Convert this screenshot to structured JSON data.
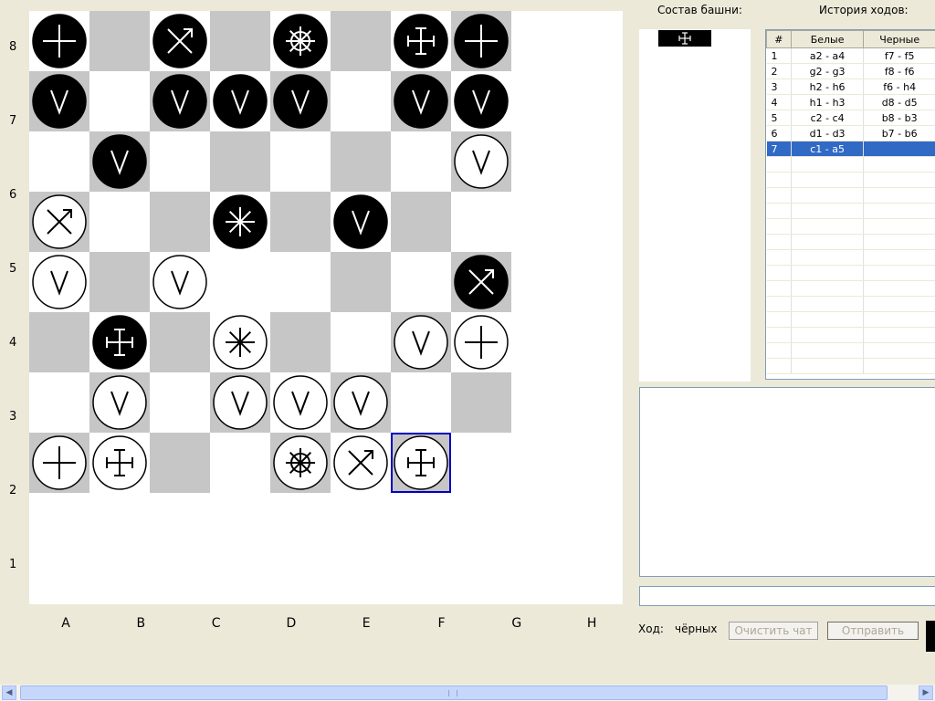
{
  "board": {
    "ranks": [
      "8",
      "7",
      "6",
      "5",
      "4",
      "3",
      "2",
      "1"
    ],
    "files": [
      "A",
      "B",
      "C",
      "D",
      "E",
      "F",
      "G",
      "H"
    ],
    "rows": [
      [
        "bK",
        "g",
        "bX",
        "g",
        "bW",
        "g",
        "bT",
        "bK"
      ],
      [
        "bV",
        "w",
        "bV",
        "bV",
        "bV",
        "w",
        "bV",
        "bV"
      ],
      [
        "w",
        "bV",
        "w",
        "g",
        "w",
        "g",
        "w",
        "wV"
      ],
      [
        "wX",
        "w",
        "g",
        "bS",
        "g",
        "bV",
        "g",
        "w"
      ],
      [
        "wV",
        "g",
        "wV",
        "w",
        "w",
        "g",
        "w",
        "bX"
      ],
      [
        "g",
        "bT",
        "g",
        "wS",
        "g",
        "w",
        "wV",
        "wK"
      ],
      [
        "w",
        "wV",
        "w",
        "wV",
        "wV",
        "wV",
        "w",
        "g"
      ],
      [
        "wK",
        "wT",
        "g",
        "w",
        "wW",
        "wX",
        "wT",
        "w"
      ]
    ],
    "selected_square": "g1"
  },
  "tower": {
    "title": "Состав башни:"
  },
  "history": {
    "title": "История ходов:",
    "columns": [
      "#",
      "Белые",
      "Черные"
    ],
    "rows": [
      [
        "1",
        "a2 - a4",
        "f7 - f5"
      ],
      [
        "2",
        "g2 - g3",
        "f8 - f6"
      ],
      [
        "3",
        "h2 - h6",
        "f6 - h4"
      ],
      [
        "4",
        "h1 - h3",
        "d8 - d5"
      ],
      [
        "5",
        "c2 - c4",
        "b8 - b3"
      ],
      [
        "6",
        "d1 - d3",
        "b7 - b6"
      ],
      [
        "7",
        "c1 - a5",
        ""
      ]
    ],
    "selected_row": 6
  },
  "status": {
    "turn_label": "Ход:",
    "turn_value": "чёрных"
  },
  "buttons": {
    "clear_chat": "Очистить чат",
    "send": "Отправить"
  },
  "colors": {
    "dark_square": "#c6c6c6",
    "light_square": "#ffffff",
    "selection": "#0000c0",
    "selected_row": "#316ac5"
  }
}
